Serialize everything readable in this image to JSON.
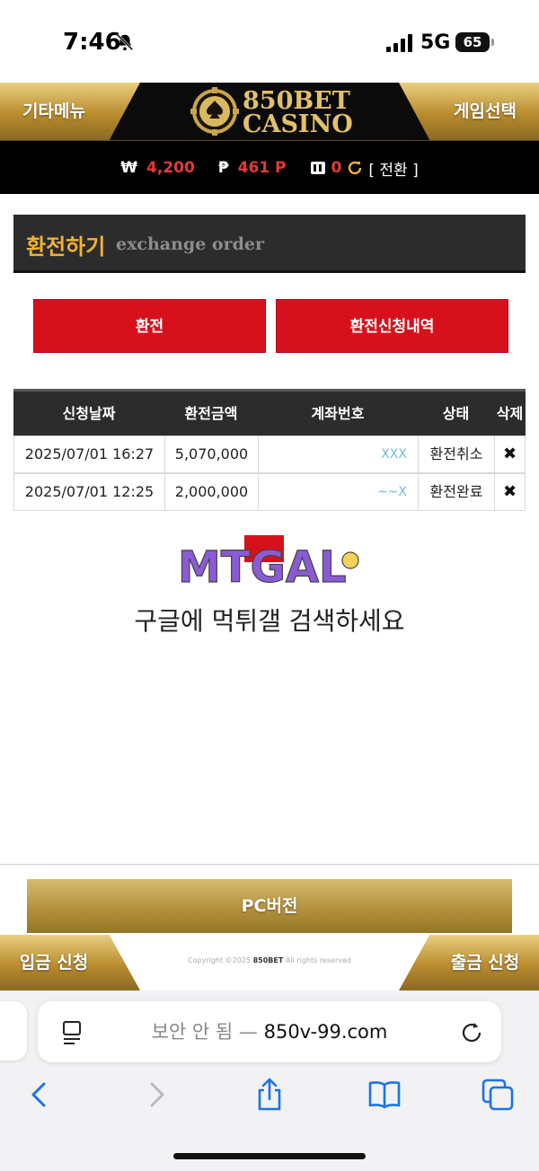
{
  "status_bar": {
    "time": "7:46",
    "network": "5G",
    "battery": "65"
  },
  "header": {
    "left_menu": "기타메뉴",
    "right_menu": "게임선택",
    "logo_line1": "850BET",
    "logo_line2": "CASINO"
  },
  "balance": {
    "won_symbol": "₩",
    "won_amount": "4,200",
    "point_symbol": "₱",
    "point_amount": "461 P",
    "chip_amount": "0",
    "switch_label": "[ 전환 ]"
  },
  "section": {
    "title_ko": "환전하기",
    "title_en": "exchange order"
  },
  "tabs": {
    "exchange": "환전",
    "history": "환전신청내역"
  },
  "table": {
    "headers": [
      "신청날짜",
      "환전금액",
      "계좌번호",
      "상태",
      "삭제"
    ],
    "rows": [
      {
        "date": "2025/07/01 16:27",
        "amount": "5,070,000",
        "account": "XXX",
        "status": "환전취소",
        "delete": "✖"
      },
      {
        "date": "2025/07/01 12:25",
        "amount": "2,000,000",
        "account": "~~X",
        "status": "환전완료",
        "delete": "✖"
      }
    ]
  },
  "watermark": {
    "brand": "MTGAL",
    "caption": "구글에 먹튀갤 검색하세요"
  },
  "pc_button": "PC버전",
  "footer": {
    "deposit": "입금 신청",
    "withdraw": "출금 신청",
    "copyright_prefix": "Copyright ©2025",
    "copyright_brand": "850BET",
    "copyright_suffix": "All rights reserved"
  },
  "browser": {
    "insecure_label": "보안 안 됨 — ",
    "host": "850v-99.com"
  },
  "colors": {
    "gold": "#b98c2e",
    "red_button": "#d7111c",
    "heading_accent": "#f2b233"
  }
}
